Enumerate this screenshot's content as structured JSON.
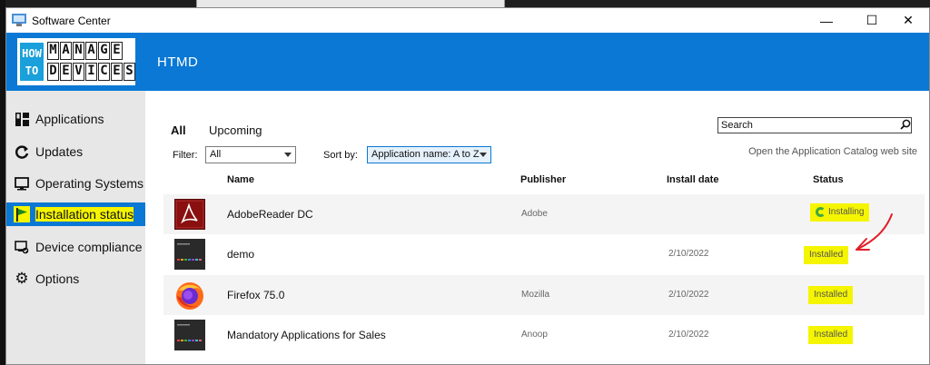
{
  "window": {
    "title": "Software Center",
    "controls": {
      "minimize": "—",
      "maximize": "☐",
      "close": "✕"
    }
  },
  "header": {
    "logo_left": [
      "HOW",
      "TO"
    ],
    "logo_row1": [
      "M",
      "A",
      "N",
      "A",
      "G",
      "E"
    ],
    "logo_row2": [
      "D",
      "E",
      "V",
      "I",
      "C",
      "E",
      "S"
    ],
    "title": "HTMD"
  },
  "sidebar": {
    "items": [
      {
        "label": "Applications",
        "icon": "applications-grid-icon",
        "active": false
      },
      {
        "label": "Updates",
        "icon": "refresh-icon",
        "active": false
      },
      {
        "label": "Operating Systems",
        "icon": "monitor-icon",
        "active": false
      },
      {
        "label": "Installation status",
        "icon": "flag-icon",
        "active": true
      },
      {
        "label": "Device compliance",
        "icon": "compliance-icon",
        "active": false
      },
      {
        "label": "Options",
        "icon": "gear-icon",
        "active": false
      }
    ]
  },
  "main": {
    "tabs": [
      {
        "label": "All",
        "active": true
      },
      {
        "label": "Upcoming",
        "active": false
      }
    ],
    "search": {
      "value": "Search"
    },
    "filter": {
      "label": "Filter:",
      "value": "All"
    },
    "sort": {
      "label": "Sort by:",
      "value": "Application name: A to Z"
    },
    "catalog_link": "Open the Application Catalog web site",
    "columns": {
      "name": "Name",
      "publisher": "Publisher",
      "install_date": "Install date",
      "status": "Status"
    },
    "rows": [
      {
        "name": "AdobeReader DC",
        "publisher": "Adobe",
        "install_date": "",
        "status": "Installing",
        "icon": "adobe-reader-icon"
      },
      {
        "name": "demo",
        "publisher": "",
        "install_date": "2/10/2022",
        "status": "Installed",
        "icon": "app-thumbnail-icon"
      },
      {
        "name": "Firefox 75.0",
        "publisher": "Mozilla",
        "install_date": "2/10/2022",
        "status": "Installed",
        "icon": "firefox-icon"
      },
      {
        "name": "Mandatory Applications for Sales",
        "publisher": "Anoop",
        "install_date": "2/10/2022",
        "status": "Installed",
        "icon": "app-thumbnail-icon"
      }
    ]
  },
  "colors": {
    "accent": "#0a78d4",
    "highlight": "#f5f500",
    "annotation": "#e0202a",
    "sidebar_bg": "#e7e7e7"
  }
}
